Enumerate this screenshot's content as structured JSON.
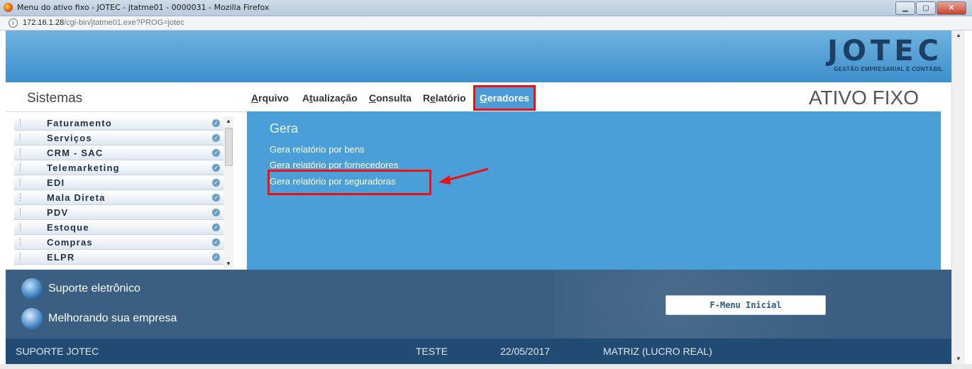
{
  "window": {
    "title": "Menu do ativo fixo - JOTEC - jtatme01 - 0000031 - Mozilla Firefox"
  },
  "address": {
    "host": "172.16.1.28",
    "path": "/cgi-bin/jtatme01.exe?PROG=jotec"
  },
  "logo": {
    "name": "JOTEC",
    "tagline": "GESTÃO EMPRESARIAL E CONTÁBIL"
  },
  "sidebar": {
    "title": "Sistemas",
    "items": [
      {
        "label": "Faturamento"
      },
      {
        "label": "Serviços"
      },
      {
        "label": "CRM - SAC"
      },
      {
        "label": "Telemarketing"
      },
      {
        "label": "EDI"
      },
      {
        "label": "Mala Direta"
      },
      {
        "label": "PDV"
      },
      {
        "label": "Estoque"
      },
      {
        "label": "Compras"
      },
      {
        "label": "ELPR"
      }
    ]
  },
  "menubar": {
    "arquivo": {
      "u": "A",
      "rest": "rquivo"
    },
    "atualizacao": {
      "pre": "A",
      "u": "t",
      "rest": "ualização"
    },
    "consulta": {
      "u": "C",
      "rest": "onsulta"
    },
    "relatorio": {
      "pre": "R",
      "u": "e",
      "rest": "latório"
    },
    "geradores": {
      "u": "G",
      "rest": "eradores"
    },
    "module_title": "ATIVO FIXO"
  },
  "content": {
    "section_title": "Gera",
    "links": [
      "Gera relatório por bens",
      "Gera relatório por fornecedores",
      "Gera relatório por seguradoras"
    ]
  },
  "footer": {
    "support": "Suporte eletrônico",
    "improve": "Melhorando sua empresa",
    "fmenu": "F-Menu Inicial"
  },
  "status": {
    "support": "SUPORTE JOTEC",
    "user": "TESTE",
    "date": "22/05/2017",
    "company": "MATRIZ (LUCRO REAL)"
  },
  "colors": {
    "accent": "#4a9fd9",
    "highlight": "#ee1111",
    "footer": "#3a5f82",
    "status": "#214b72"
  }
}
